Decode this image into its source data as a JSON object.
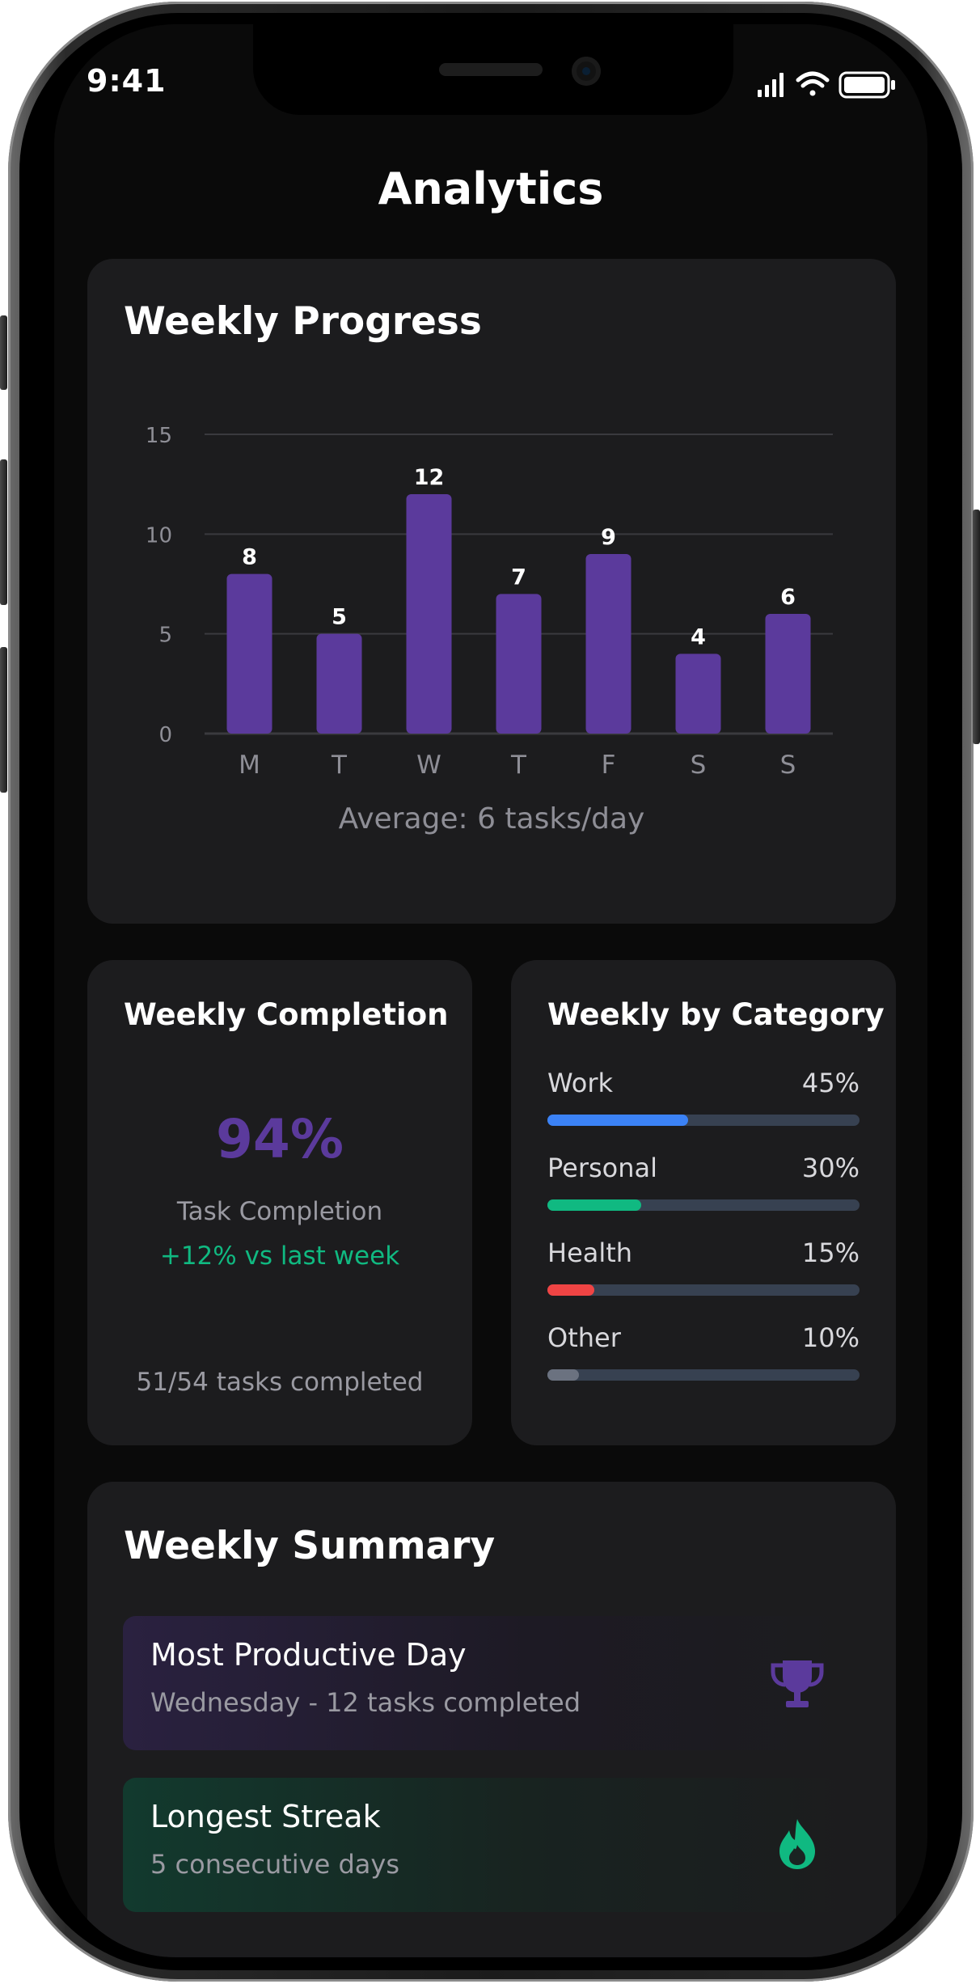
{
  "status_bar": {
    "time": "9:41"
  },
  "header": {
    "title": "Analytics"
  },
  "weekly_progress": {
    "title": "Weekly Progress",
    "average_text": "Average: 6 tasks/day"
  },
  "chart_data": {
    "type": "bar",
    "categories": [
      "M",
      "T",
      "W",
      "T",
      "F",
      "S",
      "S"
    ],
    "values": [
      8,
      5,
      12,
      7,
      9,
      4,
      6
    ],
    "ylim": [
      0,
      15
    ],
    "yticks": [
      0,
      5,
      10,
      15
    ],
    "grid": true,
    "bar_color": "#5b3a9c"
  },
  "weekly_completion": {
    "title": "Weekly Completion",
    "percent": "94%",
    "label": "Task Completion",
    "change": "+12% vs last week",
    "count": "51/54 tasks completed"
  },
  "weekly_by_category": {
    "title": "Weekly by Category",
    "items": [
      {
        "name": "Work",
        "percent_label": "45%",
        "value": 45,
        "color": "#3b82f6"
      },
      {
        "name": "Personal",
        "percent_label": "30%",
        "value": 30,
        "color": "#10b981"
      },
      {
        "name": "Health",
        "percent_label": "15%",
        "value": 15,
        "color": "#ef4444"
      },
      {
        "name": "Other",
        "percent_label": "10%",
        "value": 10,
        "color": "#6b7280"
      }
    ]
  },
  "weekly_summary": {
    "title": "Weekly Summary",
    "items": [
      {
        "title": "Most Productive Day",
        "subtitle": "Wednesday - 12 tasks completed",
        "icon": "trophy-icon",
        "color": "#5b3a9c"
      },
      {
        "title": "Longest Streak",
        "subtitle": "5 consecutive days",
        "icon": "flame-icon",
        "color": "#10b981"
      }
    ]
  }
}
